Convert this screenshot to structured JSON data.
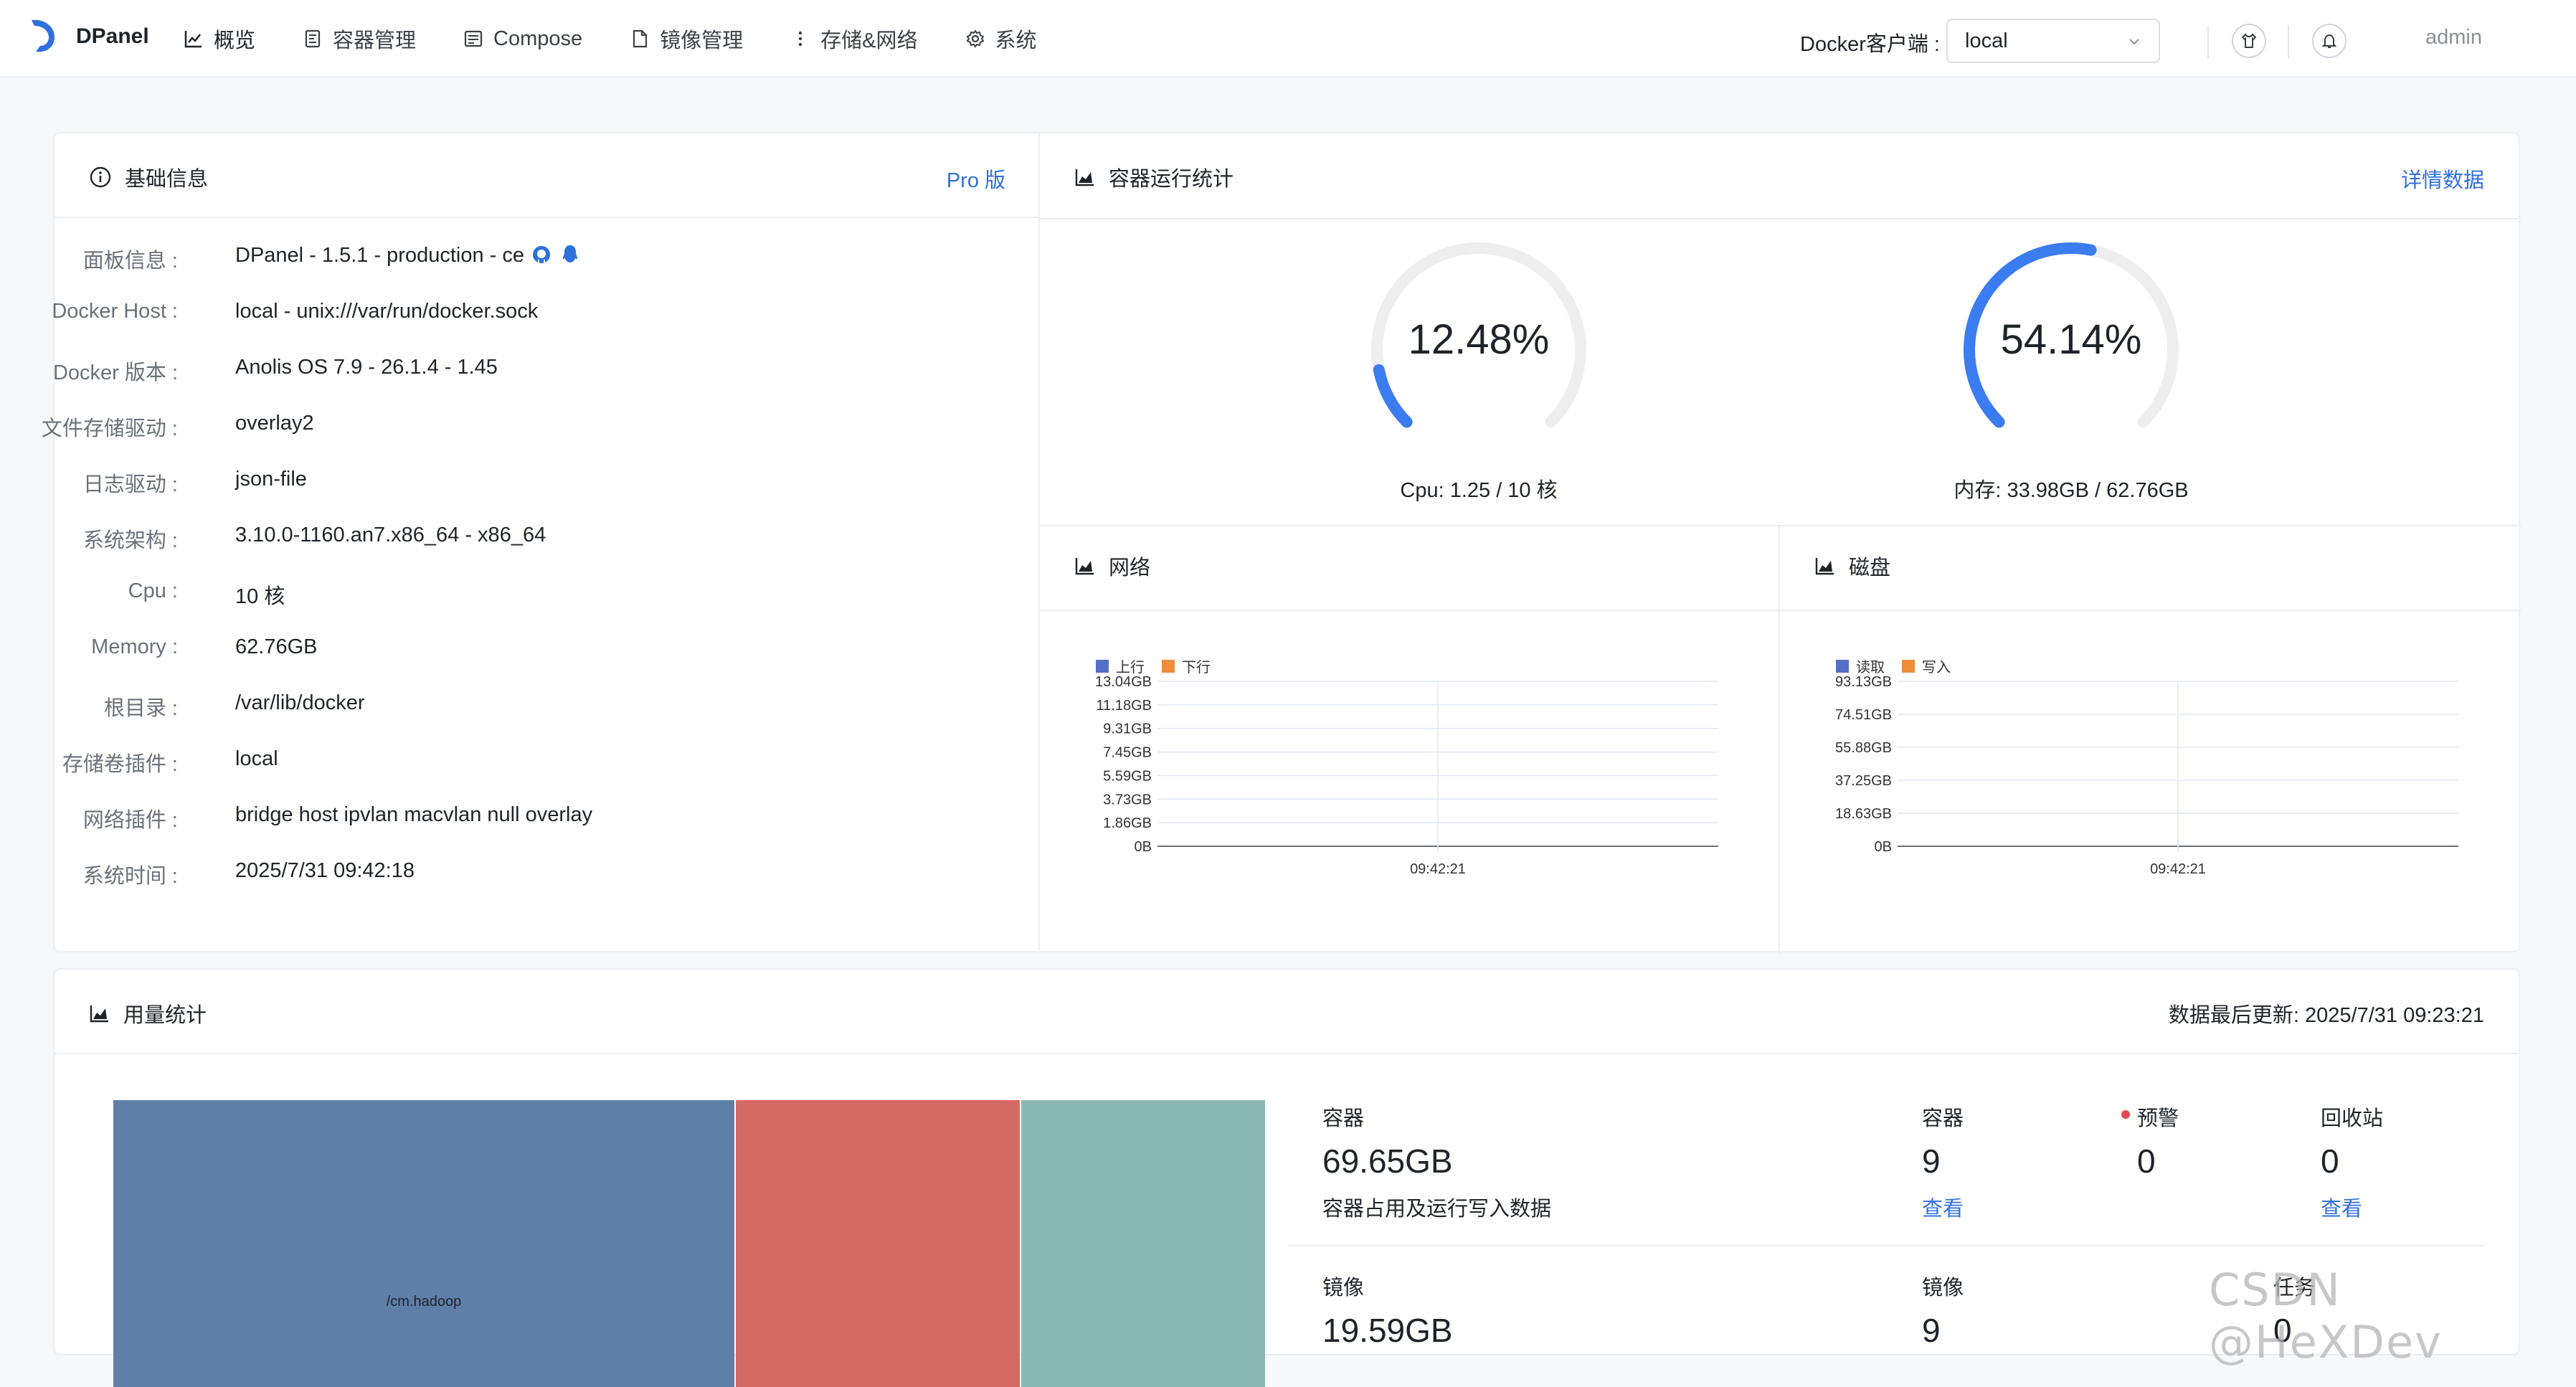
{
  "app": {
    "brand": "DPanel",
    "user": "admin"
  },
  "nav": [
    {
      "label": "概览",
      "icon": "chart-icon"
    },
    {
      "label": "容器管理",
      "icon": "container-icon"
    },
    {
      "label": "Compose",
      "icon": "compose-icon"
    },
    {
      "label": "镜像管理",
      "icon": "file-icon"
    },
    {
      "label": "存储&网络",
      "icon": "more-vertical-icon"
    },
    {
      "label": "系统",
      "icon": "gear-icon"
    }
  ],
  "client": {
    "label": "Docker客户端 :",
    "value": "local"
  },
  "basic": {
    "title": "基础信息",
    "pro": "Pro 版",
    "rows": [
      {
        "label": "面板信息 :",
        "value": "DPanel - 1.5.1 - production - ce"
      },
      {
        "label": "Docker Host :",
        "value": "local - unix:///var/run/docker.sock"
      },
      {
        "label": "Docker 版本 :",
        "value": "Anolis OS 7.9 - 26.1.4 - 1.45"
      },
      {
        "label": "文件存储驱动 :",
        "value": "overlay2"
      },
      {
        "label": "日志驱动 :",
        "value": "json-file"
      },
      {
        "label": "系统架构 :",
        "value": "3.10.0-1160.an7.x86_64 - x86_64"
      },
      {
        "label": "Cpu :",
        "value": "10 核"
      },
      {
        "label": "Memory :",
        "value": "62.76GB"
      },
      {
        "label": "根目录 :",
        "value": "/var/lib/docker"
      },
      {
        "label": "存储卷插件 :",
        "value": "local"
      },
      {
        "label": "网络插件 :",
        "value": "bridge  host  ipvlan  macvlan  null  overlay"
      },
      {
        "label": "系统时间 :",
        "value": "2025/7/31 09:42:18"
      }
    ]
  },
  "stats": {
    "title": "容器运行统计",
    "link": "详情数据",
    "cpu": {
      "percent": 12.48,
      "percent_text": "12.48%",
      "caption": "Cpu: 1.25 / 10 核"
    },
    "mem": {
      "percent": 54.14,
      "percent_text": "54.14%",
      "caption": "内存: 33.98GB / 62.76GB"
    }
  },
  "network": {
    "title": "网络",
    "legend": [
      "上行",
      "下行"
    ],
    "yticks": [
      "13.04GB",
      "11.18GB",
      "9.31GB",
      "7.45GB",
      "5.59GB",
      "3.73GB",
      "1.86GB",
      "0B"
    ],
    "xtick": "09:42:21"
  },
  "disk": {
    "title": "磁盘",
    "legend": [
      "读取",
      "写入"
    ],
    "yticks": [
      "93.13GB",
      "74.51GB",
      "55.88GB",
      "37.25GB",
      "18.63GB",
      "0B"
    ],
    "xtick": "09:42:21"
  },
  "usage": {
    "title": "用量统计",
    "updated": "数据最后更新: 2025/7/31 09:23:21",
    "treemap_label": "/cm.hadoop",
    "container_label": "容器",
    "container_size": "69.65GB",
    "container_desc": "容器占用及运行写入数据",
    "count_label": "容器",
    "count_value": "9",
    "view1": "查看",
    "warn_label": "预警",
    "warn_value": "0",
    "recycle_label": "回收站",
    "recycle_value": "0",
    "view2": "查看",
    "image_label": "镜像",
    "image_size": "19.59GB",
    "image_count_label": "镜像",
    "image_count": "9",
    "task_label": "任务",
    "task_value": "0"
  },
  "colors": {
    "accent": "#2f6fde",
    "gauge": "#3b7cf0",
    "series_up": "#5470c6",
    "series_down": "#ee8c3a",
    "tm1": "#5f7fa8",
    "tm2": "#d46a64",
    "tm3": "#8cb8b3"
  },
  "watermark": "CSDN @HeXDev"
}
